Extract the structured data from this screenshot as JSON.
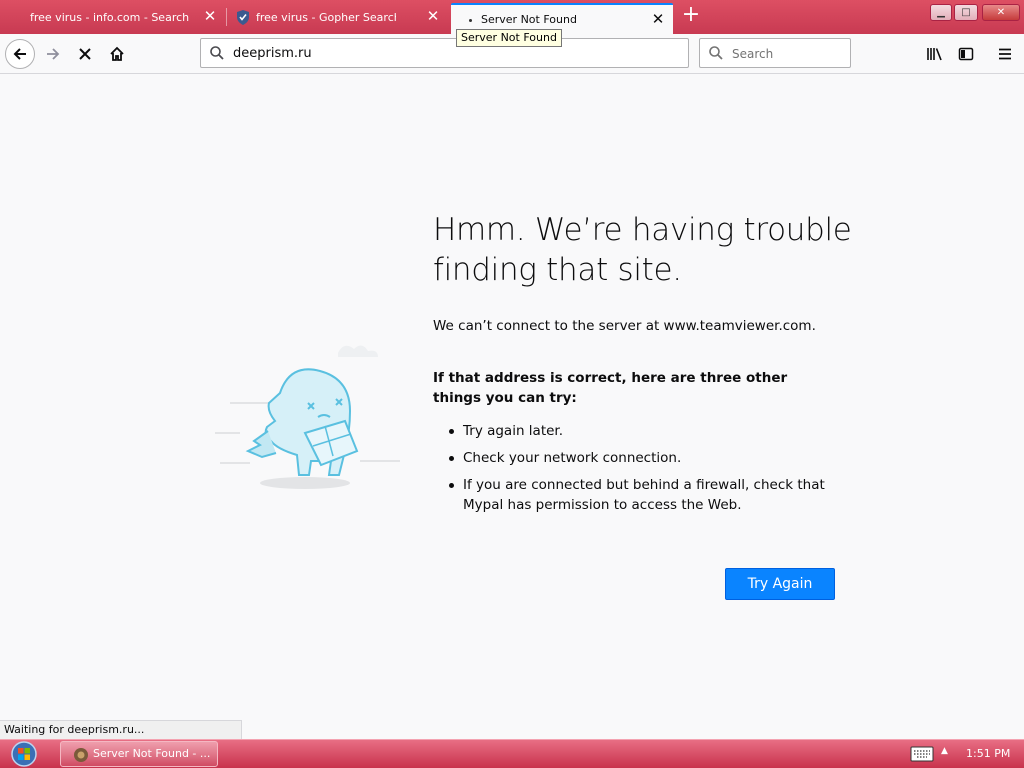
{
  "tabs": [
    {
      "title": "free virus - info.com - Search Th",
      "close": "✕"
    },
    {
      "title": "free virus - Gopher Search Hom",
      "close": "✕"
    },
    {
      "title": "Server Not Found",
      "close": "✕"
    }
  ],
  "new_tab": "+",
  "window_controls": {
    "min": "▁",
    "max": "□",
    "close": "✕"
  },
  "tooltip": "Server Not Found",
  "nav": {
    "url": "deeprism.ru",
    "search_placeholder": "Search"
  },
  "error": {
    "title": "Hmm. We’re having trouble finding that site.",
    "description": "We can’t connect to the server at www.teamviewer.com.",
    "tips_heading": "If that address is correct, here are three other things you can try:",
    "tips": [
      "Try again later.",
      "Check your network connection.",
      "If you are connected but behind a firewall, check that Mypal has permission to access the Web."
    ],
    "button": "Try Again"
  },
  "status_text": "Waiting for deeprism.ru...",
  "taskbar": {
    "task_label": "Server Not Found - ...",
    "clock": "1:51 PM"
  },
  "colors": {
    "accent": "#0a84ff",
    "taskbar": "#d9435d",
    "illustration": "#5ac0e0"
  }
}
